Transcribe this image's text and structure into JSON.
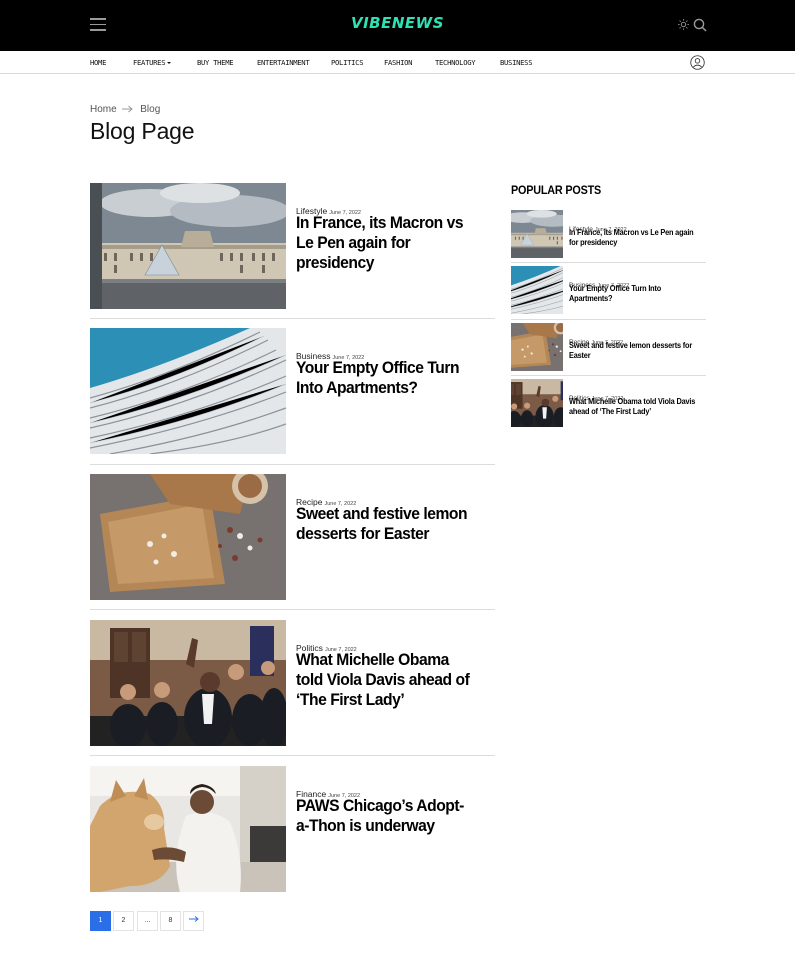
{
  "header": {
    "logo": "VIBENEWS",
    "nav": [
      "HOME",
      "FEATURES",
      "BUY THEME",
      "ENTERTAINMENT",
      "POLITICS",
      "FASHION",
      "TECHNOLOGY",
      "BUSINESS"
    ]
  },
  "breadcrumb": [
    "Home",
    "Blog"
  ],
  "page_title": "Blog Page",
  "posts": [
    {
      "category": "Lifestyle",
      "date": "June 7, 2022",
      "title": "In France, its Macron vs Le Pen again for presidency"
    },
    {
      "category": "Business",
      "date": "June 7, 2022",
      "title": "Your Empty Office Turn Into Apartments?"
    },
    {
      "category": "Recipe",
      "date": "June 7, 2022",
      "title": "Sweet and festive lemon desserts for Easter"
    },
    {
      "category": "Politics",
      "date": "June 7, 2022",
      "title": "What Michelle Obama told Viola Davis ahead of ‘The First Lady’"
    },
    {
      "category": "Finance",
      "date": "June 7, 2022",
      "title": "PAWS Chicago’s Adopt-a-Thon is underway"
    }
  ],
  "sidebar": {
    "heading": "POPULAR POSTS",
    "posts": [
      {
        "category": "Lifestyle",
        "date": "June 7, 2022",
        "title": "In France, its Macron vs Le Pen again for presidency"
      },
      {
        "category": "Business",
        "date": "June 7, 2022",
        "title": "Your Empty Office Turn Into Apartments?"
      },
      {
        "category": "Recipe",
        "date": "June 7, 2022",
        "title": "Sweet and festive lemon desserts for Easter"
      },
      {
        "category": "Politics",
        "date": "June 7, 2022",
        "title": "What Michelle Obama told Viola Davis ahead of ‘The First Lady’"
      }
    ]
  },
  "pagination": {
    "pages": [
      "1",
      "2",
      "...",
      "8"
    ],
    "current": "1"
  },
  "colors": {
    "accent": "#2de2b4",
    "active_page": "#2a6fe8",
    "topbar": "#000000"
  }
}
